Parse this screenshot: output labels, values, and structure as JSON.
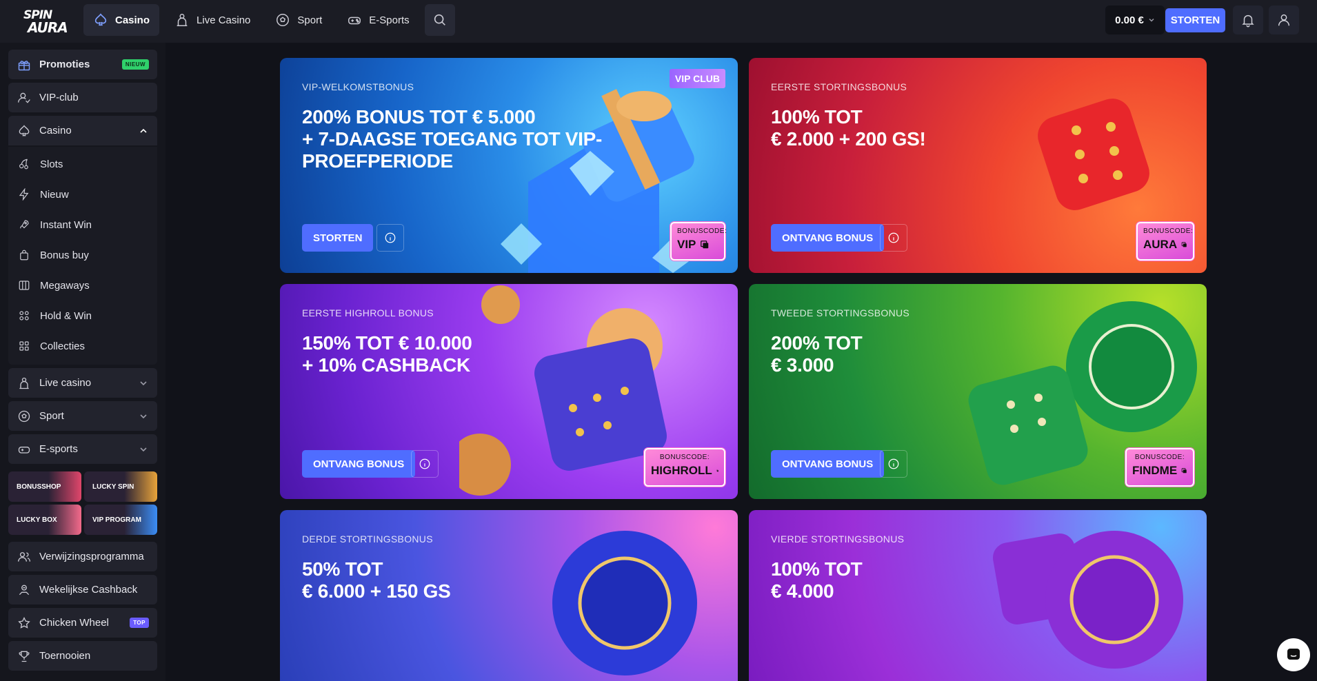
{
  "logo": {
    "line1": "SPIN",
    "line2": "AURA"
  },
  "topnav": [
    {
      "label": "Casino",
      "icon": "spade-icon",
      "active": true
    },
    {
      "label": "Live Casino",
      "icon": "dealer-icon"
    },
    {
      "label": "Sport",
      "icon": "soccer-ball-icon"
    },
    {
      "label": "E-Sports",
      "icon": "gamepad-icon"
    }
  ],
  "header": {
    "balance": "0.00 €",
    "deposit_label": "STORTEN"
  },
  "sidebar": {
    "promotions": {
      "label": "Promoties",
      "badge": "NIEUW"
    },
    "vip": {
      "label": "VIP-club"
    },
    "casino": {
      "label": "Casino"
    },
    "casino_sub": [
      "Slots",
      "Nieuw",
      "Instant Win",
      "Bonus buy",
      "Megaways",
      "Hold & Win",
      "Collecties"
    ],
    "live_casino": {
      "label": "Live casino"
    },
    "sport": {
      "label": "Sport"
    },
    "esports": {
      "label": "E-sports"
    },
    "tiles": [
      "BONUSSHOP",
      "LUCKY SPIN",
      "LUCKY BOX",
      "VIP PROGRAM"
    ],
    "referral": {
      "label": "Verwijzingsprogramma"
    },
    "cashback": {
      "label": "Wekelijkse Cashback"
    },
    "chicken": {
      "label": "Chicken Wheel",
      "badge": "TOP"
    },
    "tournaments": {
      "label": "Toernooien"
    }
  },
  "cards": [
    {
      "kicker": "VIP-WELKOMSTBONUS",
      "title_lines": [
        "200% BONUS TOT € 5.000",
        "+ 7-DAAGSE TOEGANG TOT VIP-",
        "PROEFPERIODE"
      ],
      "button": "STORTEN",
      "code_label": "BONUSCODE:",
      "code": "VIP",
      "tag": "VIP CLUB"
    },
    {
      "kicker": "EERSTE STORTINGSBONUS",
      "title_lines": [
        "100% TOT",
        "€ 2.000 + 200 GS!"
      ],
      "button": "ONTVANG BONUS",
      "code_label": "BONUSCODE:",
      "code": "AURA"
    },
    {
      "kicker": "EERSTE HIGHROLL BONUS",
      "title_lines": [
        "150% TOT € 10.000",
        "+ 10% CASHBACK"
      ],
      "button": "ONTVANG BONUS",
      "code_label": "BONUSCODE:",
      "code": "HIGHROLL"
    },
    {
      "kicker": "TWEEDE STORTINGSBONUS",
      "title_lines": [
        "200% TOT",
        "€ 3.000"
      ],
      "button": "ONTVANG BONUS",
      "code_label": "BONUSCODE:",
      "code": "FINDME"
    },
    {
      "kicker": "DERDE STORTINGSBONUS",
      "title_lines": [
        "50% TOT",
        "€ 6.000 + 150 GS"
      ]
    },
    {
      "kicker": "VIERDE STORTINGSBONUS",
      "title_lines": [
        "100% TOT",
        "€ 4.000"
      ]
    }
  ],
  "colors": {
    "accent": "#4f6dff",
    "new_badge": "#2fd16b",
    "top_badge": "#6a5cff"
  }
}
